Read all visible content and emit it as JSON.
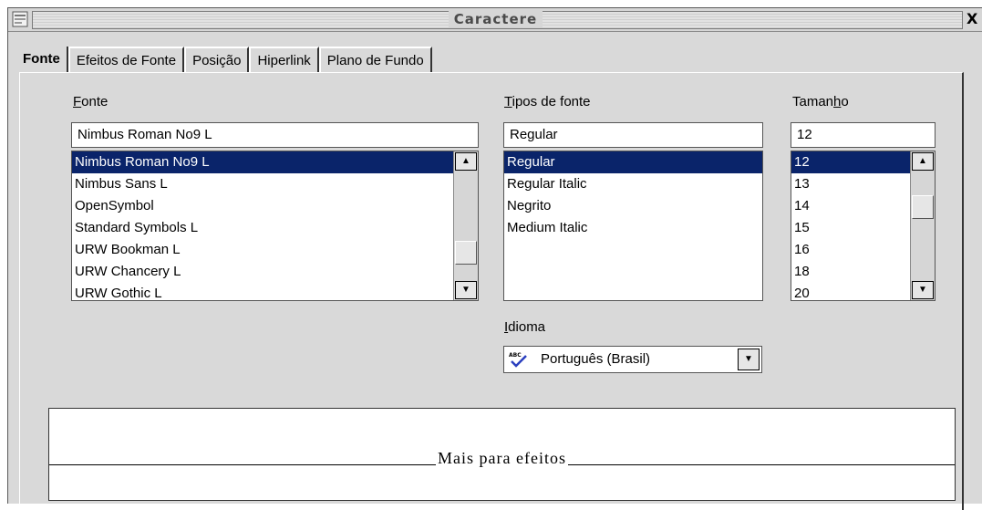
{
  "window": {
    "title": "Caractere",
    "close_glyph": "X"
  },
  "tabs": [
    {
      "label": "Fonte",
      "active": true
    },
    {
      "label": "Efeitos de Fonte",
      "active": false
    },
    {
      "label": "Posição",
      "active": false
    },
    {
      "label": "Hiperlink",
      "active": false
    },
    {
      "label": "Plano de Fundo",
      "active": false
    }
  ],
  "font": {
    "label_mnemonic": "F",
    "label_rest": "onte",
    "value": "Nimbus Roman No9 L",
    "items": [
      "Nimbus Roman No9 L",
      "Nimbus Sans L",
      "OpenSymbol",
      "Standard Symbols L",
      "URW Bookman L",
      "URW Chancery L",
      "URW Gothic L"
    ],
    "selected": "Nimbus Roman No9 L"
  },
  "style": {
    "label_mnemonic": "T",
    "label_rest": "ipos de fonte",
    "value": "Regular",
    "items": [
      "Regular",
      "Regular Italic",
      "Negrito",
      "Medium Italic"
    ],
    "selected": "Regular"
  },
  "size": {
    "label_before": "Taman",
    "label_mnemonic": "h",
    "label_after": "o",
    "value": "12",
    "items": [
      "12",
      "13",
      "14",
      "15",
      "16",
      "18",
      "20"
    ],
    "selected": "12"
  },
  "language": {
    "label_mnemonic": "I",
    "label_rest": "dioma",
    "value": "Português (Brasil)",
    "icon": "spellcheck-abc-icon"
  },
  "preview": {
    "text": "Mais para efeitos"
  }
}
